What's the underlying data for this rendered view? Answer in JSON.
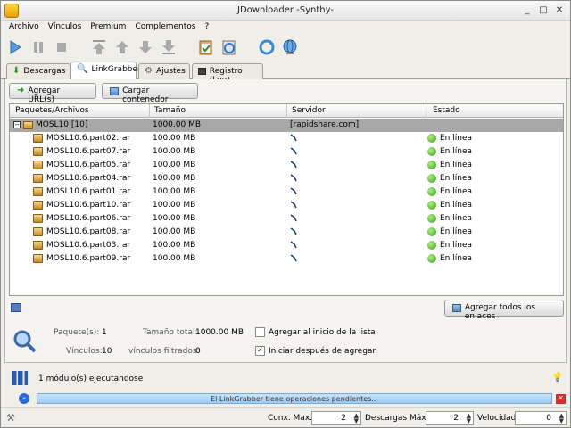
{
  "window": {
    "title": "JDownloader -Synthy-"
  },
  "menu": [
    "Archivo",
    "Vínculos",
    "Premium",
    "Complementos",
    "?"
  ],
  "tabs": [
    {
      "label": "Descargas"
    },
    {
      "label": "LinkGrabber"
    },
    {
      "label": "Ajustes"
    },
    {
      "label": "Registro (Log)"
    }
  ],
  "panel": {
    "add_url": "Agregar URL(s)",
    "load_container": "Cargar contenedor",
    "add_all": "Agregar todos los enlaces"
  },
  "table": {
    "headers": [
      "Paquetes/Archivos",
      "Tamaño",
      "Servidor",
      "Estado"
    ],
    "package": {
      "name": "MOSL10 [10]",
      "size": "1000.00 MB",
      "server": "[rapidshare.com]"
    },
    "files": [
      {
        "name": "MOSL10.6.part02.rar",
        "size": "100.00 MB",
        "status": "En línea"
      },
      {
        "name": "MOSL10.6.part07.rar",
        "size": "100.00 MB",
        "status": "En línea"
      },
      {
        "name": "MOSL10.6.part05.rar",
        "size": "100.00 MB",
        "status": "En línea"
      },
      {
        "name": "MOSL10.6.part04.rar",
        "size": "100.00 MB",
        "status": "En línea"
      },
      {
        "name": "MOSL10.6.part01.rar",
        "size": "100.00 MB",
        "status": "En línea"
      },
      {
        "name": "MOSL10.6.part10.rar",
        "size": "100.00 MB",
        "status": "En línea"
      },
      {
        "name": "MOSL10.6.part06.rar",
        "size": "100.00 MB",
        "status": "En línea"
      },
      {
        "name": "MOSL10.6.part08.rar",
        "size": "100.00 MB",
        "status": "En línea"
      },
      {
        "name": "MOSL10.6.part03.rar",
        "size": "100.00 MB",
        "status": "En línea"
      },
      {
        "name": "MOSL10.6.part09.rar",
        "size": "100.00 MB",
        "status": "En línea"
      }
    ]
  },
  "info": {
    "packages_label": "Paquete(s):",
    "packages_value": "1",
    "total_size_label": "Tamaño total:",
    "total_size_value": "1000.00 MB",
    "links_label": "Vínculos:",
    "links_value": "10",
    "filtered_label": "vínculos filtrados:",
    "filtered_value": "0",
    "add_top_label": "Agregar al inicio de la lista",
    "start_after_label": "Iniciar después de agregar"
  },
  "status": {
    "modules": "1 módulo(s) ejecutandose",
    "progress_text": "El LinkGrabber tiene operaciones pendientes..."
  },
  "footer": {
    "conx_label": "Conx. Max.",
    "conx_value": "2",
    "downloads_label": "Descargas Máx.",
    "downloads_value": "2",
    "speed_label": "Velocidad",
    "speed_value": "0"
  },
  "colors": {
    "package_row": "#a8a8a8",
    "progress": "#9ccbf4",
    "ok": "#3aa01a"
  }
}
